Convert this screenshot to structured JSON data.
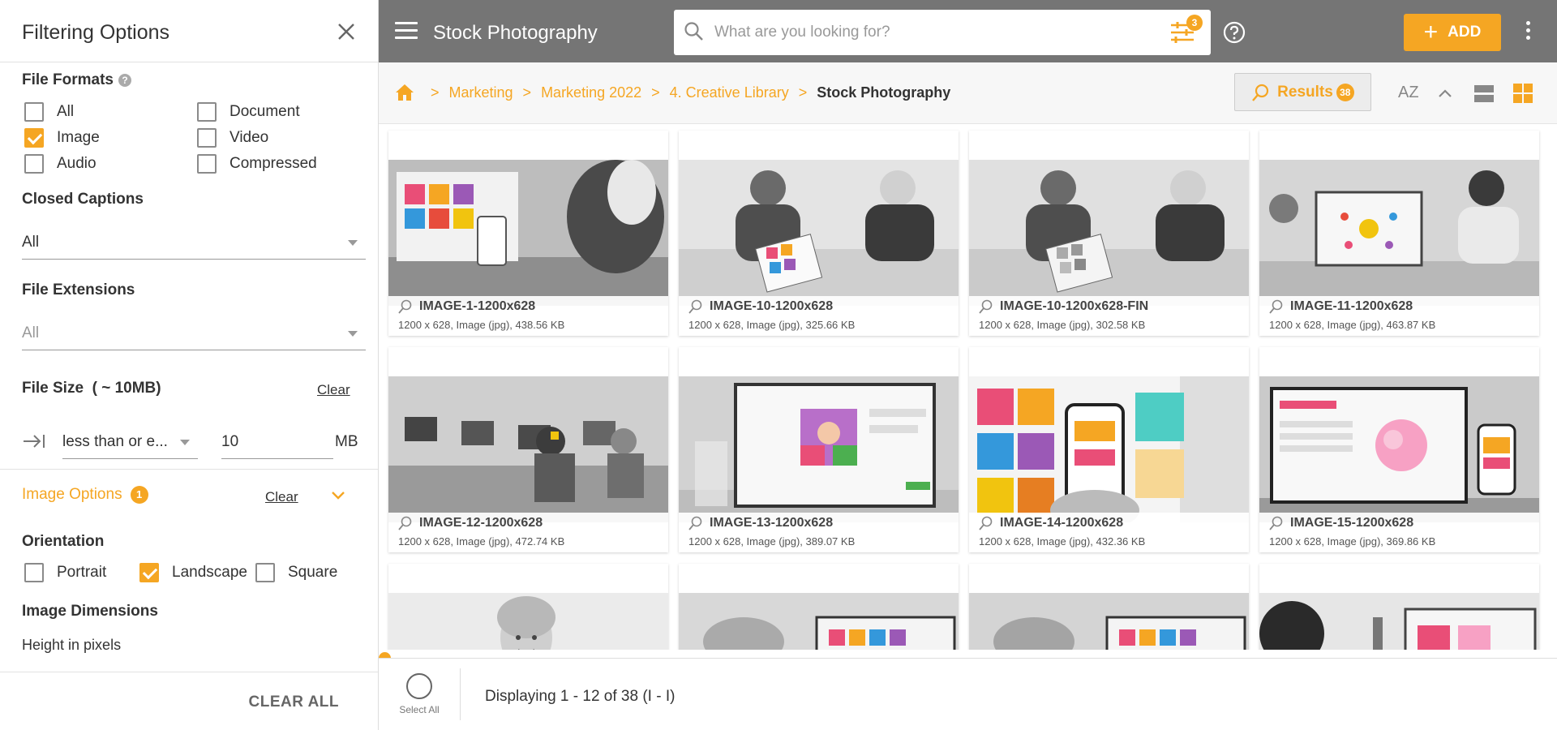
{
  "filter_panel": {
    "title": "Filtering Options",
    "file_formats": {
      "label": "File Formats",
      "options": [
        {
          "label": "All",
          "checked": false
        },
        {
          "label": "Document",
          "checked": false
        },
        {
          "label": "Image",
          "checked": true
        },
        {
          "label": "Video",
          "checked": false
        },
        {
          "label": "Audio",
          "checked": false
        },
        {
          "label": "Compressed",
          "checked": false
        }
      ]
    },
    "closed_captions": {
      "label": "Closed Captions",
      "value": "All"
    },
    "file_extensions": {
      "label": "File Extensions",
      "value": "All"
    },
    "file_size": {
      "label": "File Size  ( ~ 10MB)",
      "clear": "Clear",
      "operator": "less than or e...",
      "value": "10",
      "unit": "MB"
    },
    "image_options": {
      "label": "Image Options",
      "count": "1",
      "clear": "Clear"
    },
    "orientation": {
      "label": "Orientation",
      "options": [
        {
          "label": "Portrait",
          "checked": false
        },
        {
          "label": "Landscape",
          "checked": true
        },
        {
          "label": "Square",
          "checked": false
        }
      ]
    },
    "image_dimensions": {
      "label": "Image Dimensions",
      "height_label": "Height in pixels"
    },
    "clear_all": "CLEAR ALL"
  },
  "topbar": {
    "title": "Stock Photography",
    "search_placeholder": "What are you looking for?",
    "filter_count": "3",
    "add_label": "ADD"
  },
  "breadcrumb": {
    "items": [
      "Marketing",
      "Marketing 2022",
      "4. Creative Library"
    ],
    "current": "Stock Photography"
  },
  "toolbar": {
    "results_label": "Results",
    "results_count": "38",
    "sort_label": "AZ"
  },
  "assets": [
    {
      "name": "IMAGE-1-1200x628",
      "meta": "1200 x 628, Image (jpg), 438.56 KB"
    },
    {
      "name": "IMAGE-10-1200x628",
      "meta": "1200 x 628, Image (jpg), 325.66 KB"
    },
    {
      "name": "IMAGE-10-1200x628-FIN",
      "meta": "1200 x 628, Image (jpg), 302.58 KB"
    },
    {
      "name": "IMAGE-11-1200x628",
      "meta": "1200 x 628, Image (jpg), 463.87 KB"
    },
    {
      "name": "IMAGE-12-1200x628",
      "meta": "1200 x 628, Image (jpg), 472.74 KB"
    },
    {
      "name": "IMAGE-13-1200x628",
      "meta": "1200 x 628, Image (jpg), 389.07 KB"
    },
    {
      "name": "IMAGE-14-1200x628",
      "meta": "1200 x 628, Image (jpg), 432.36 KB"
    },
    {
      "name": "IMAGE-15-1200x628",
      "meta": "1200 x 628, Image (jpg), 369.86 KB"
    }
  ],
  "footer": {
    "select_all": "Select All",
    "displaying": "Displaying 1 - 12 of 38 (I - I)"
  },
  "colors": {
    "accent": "#f5a623",
    "topbar": "#757575"
  }
}
